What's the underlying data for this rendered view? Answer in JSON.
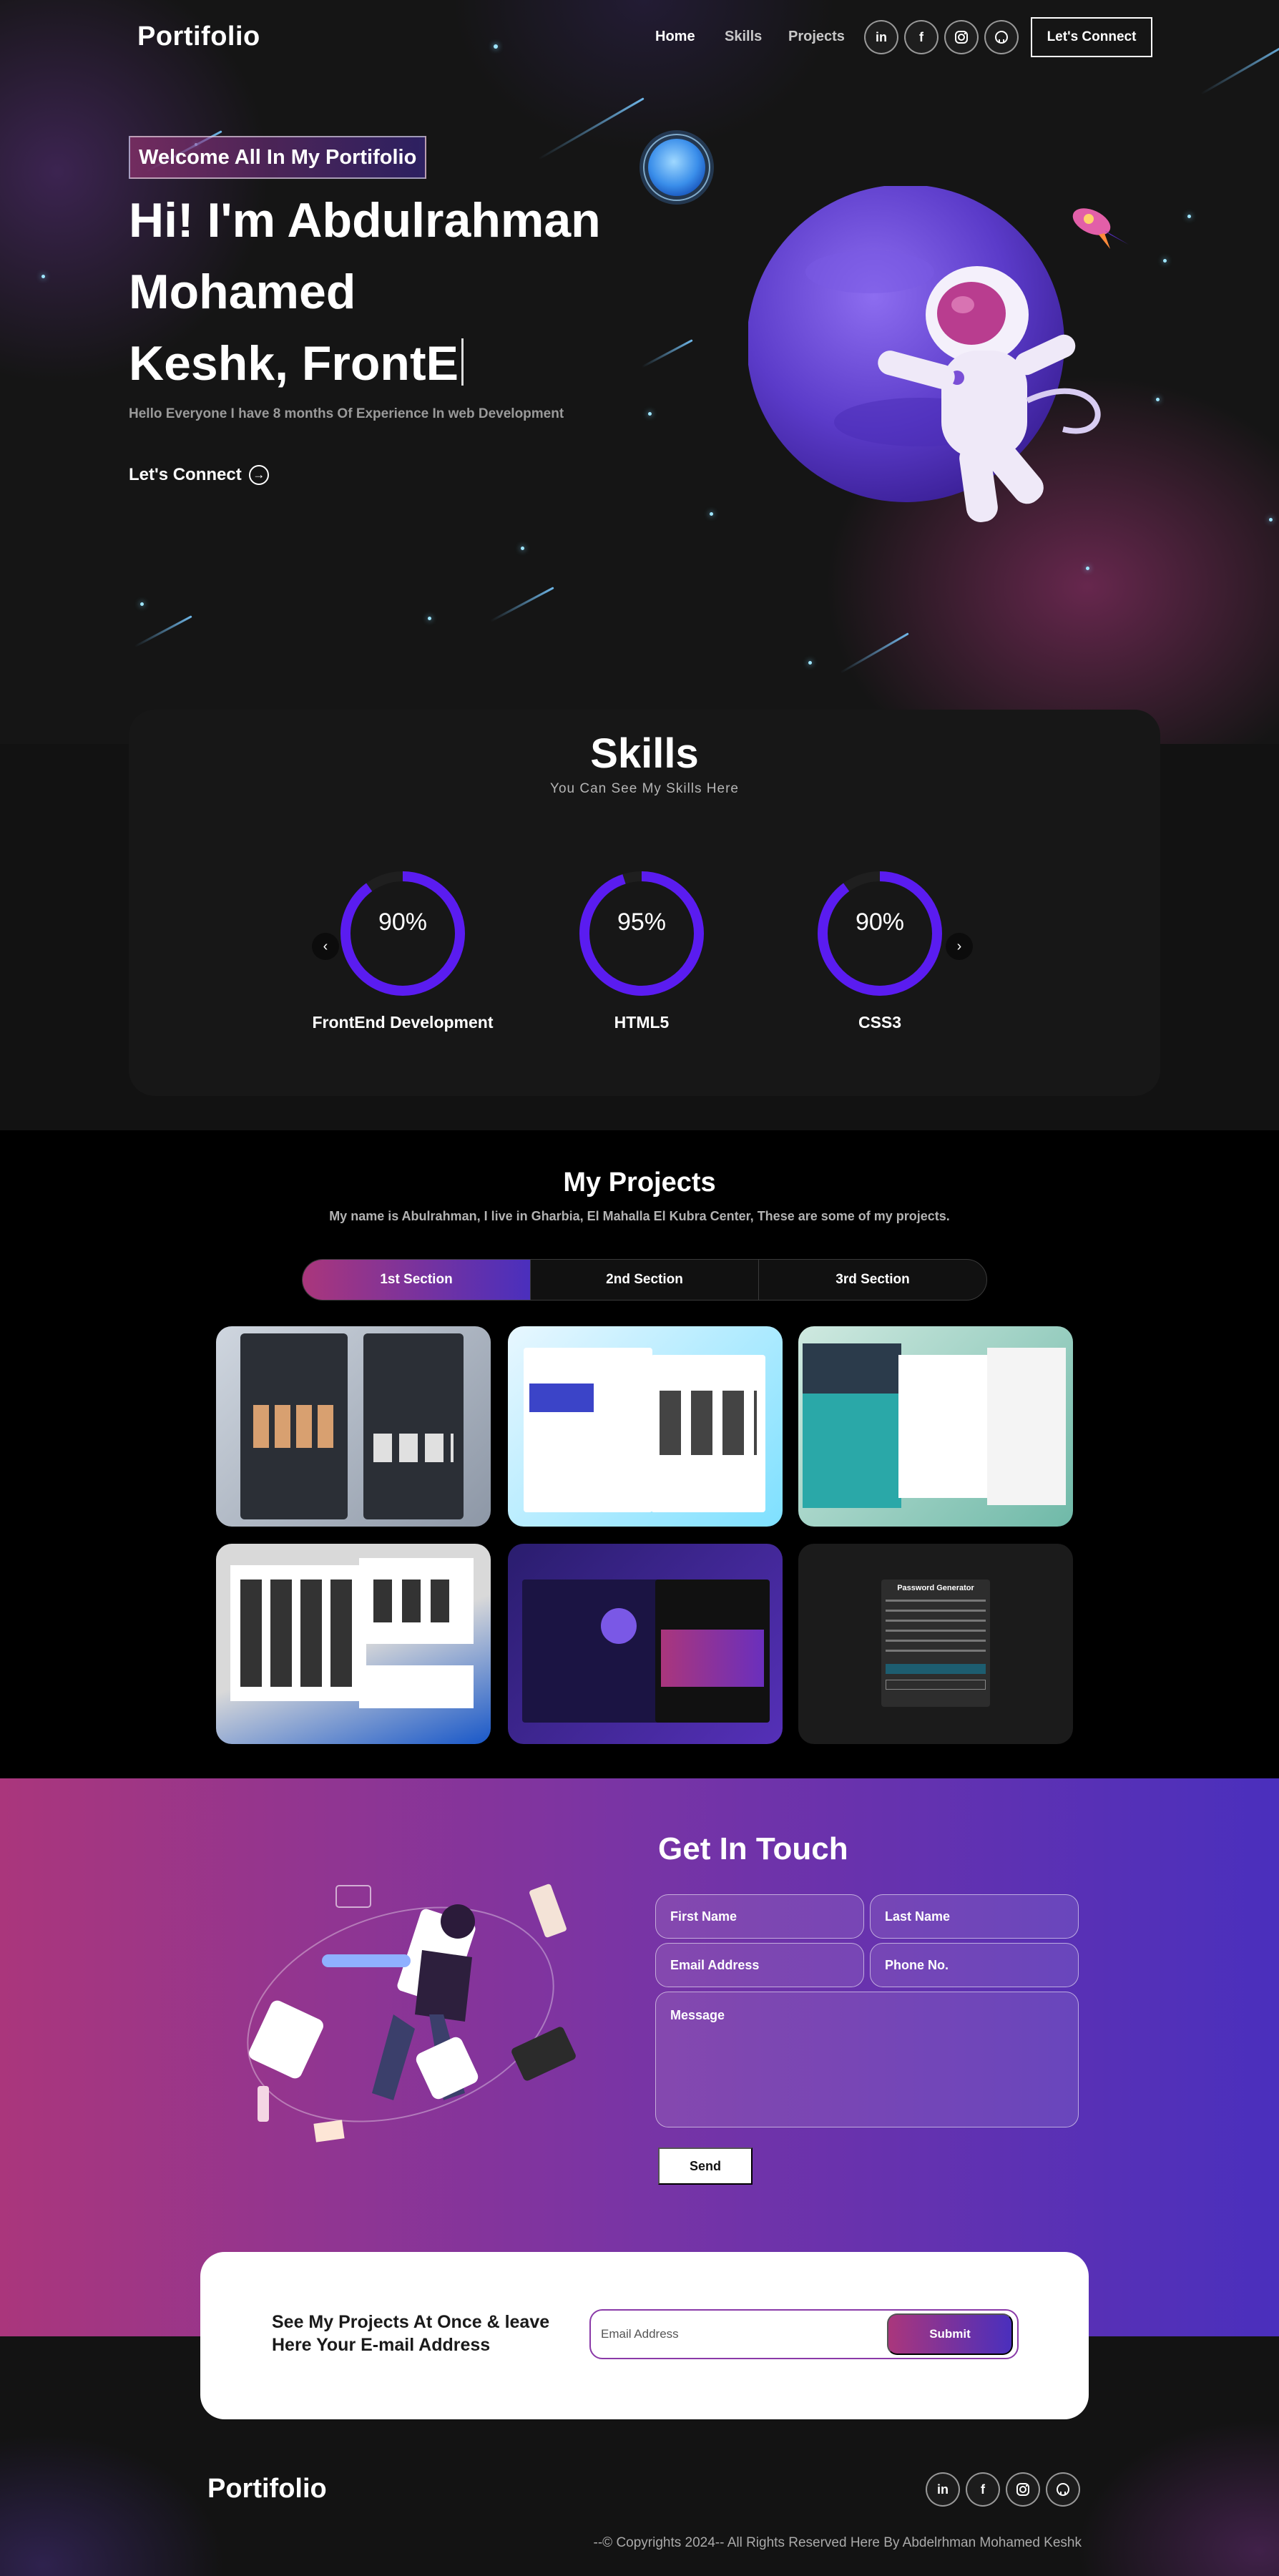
{
  "navbar": {
    "logo": "Portifolio",
    "links": [
      "Home",
      "Skills",
      "Projects"
    ],
    "socials": [
      "linkedin-icon",
      "facebook-icon",
      "instagram-icon",
      "github-icon"
    ],
    "connect_label": "Let's Connect"
  },
  "hero": {
    "tagline": "Welcome All In My Portifolio",
    "title_line1": "Hi! I'm Abdulrahman",
    "title_line2": "Mohamed",
    "title_line3": "Keshk, FrontE",
    "subtitle": "Hello Everyone I have 8 months Of Experience In web Development",
    "cta_label": "Let's Connect",
    "cta_icon": "→"
  },
  "skills": {
    "title": "Skills",
    "subtitle": "You Can See My Skills Here",
    "prev_icon": "‹",
    "next_icon": "›",
    "items": [
      {
        "label": "FrontEnd Development",
        "percent_text": "90%",
        "value": 0.9
      },
      {
        "label": "HTML5",
        "percent_text": "95%",
        "value": 0.95
      },
      {
        "label": "CSS3",
        "percent_text": "90%",
        "value": 0.9
      }
    ],
    "ring_color": "#5a1cf0"
  },
  "projects": {
    "title": "My Projects",
    "subtitle": "My name is Abulrahman, I live in Gharbia, El Mahalla El Kubra Center, These are some of my projects.",
    "tabs": [
      "1st Section",
      "2nd Section",
      "3rd Section"
    ],
    "password_card_title": "Password Generator"
  },
  "contact": {
    "title": "Get In Touch",
    "first_name": "First Name",
    "last_name": "Last Name",
    "email": "Email Address",
    "phone": "Phone No.",
    "message": "Message",
    "send_label": "Send"
  },
  "newsletter": {
    "text": "See My Projects At Once & leave Here Your E-mail Address",
    "input_placeholder": "Email Address",
    "submit_label": "Submit"
  },
  "footer": {
    "logo": "Portifolio",
    "copyright": "--© Copyrights 2024-- All Rights Reserved Here By Abdelrhman Mohamed Keshk"
  },
  "colors": {
    "accent_pink": "#aa367c",
    "accent_purple": "#4a2fbd",
    "background": "#121212"
  }
}
